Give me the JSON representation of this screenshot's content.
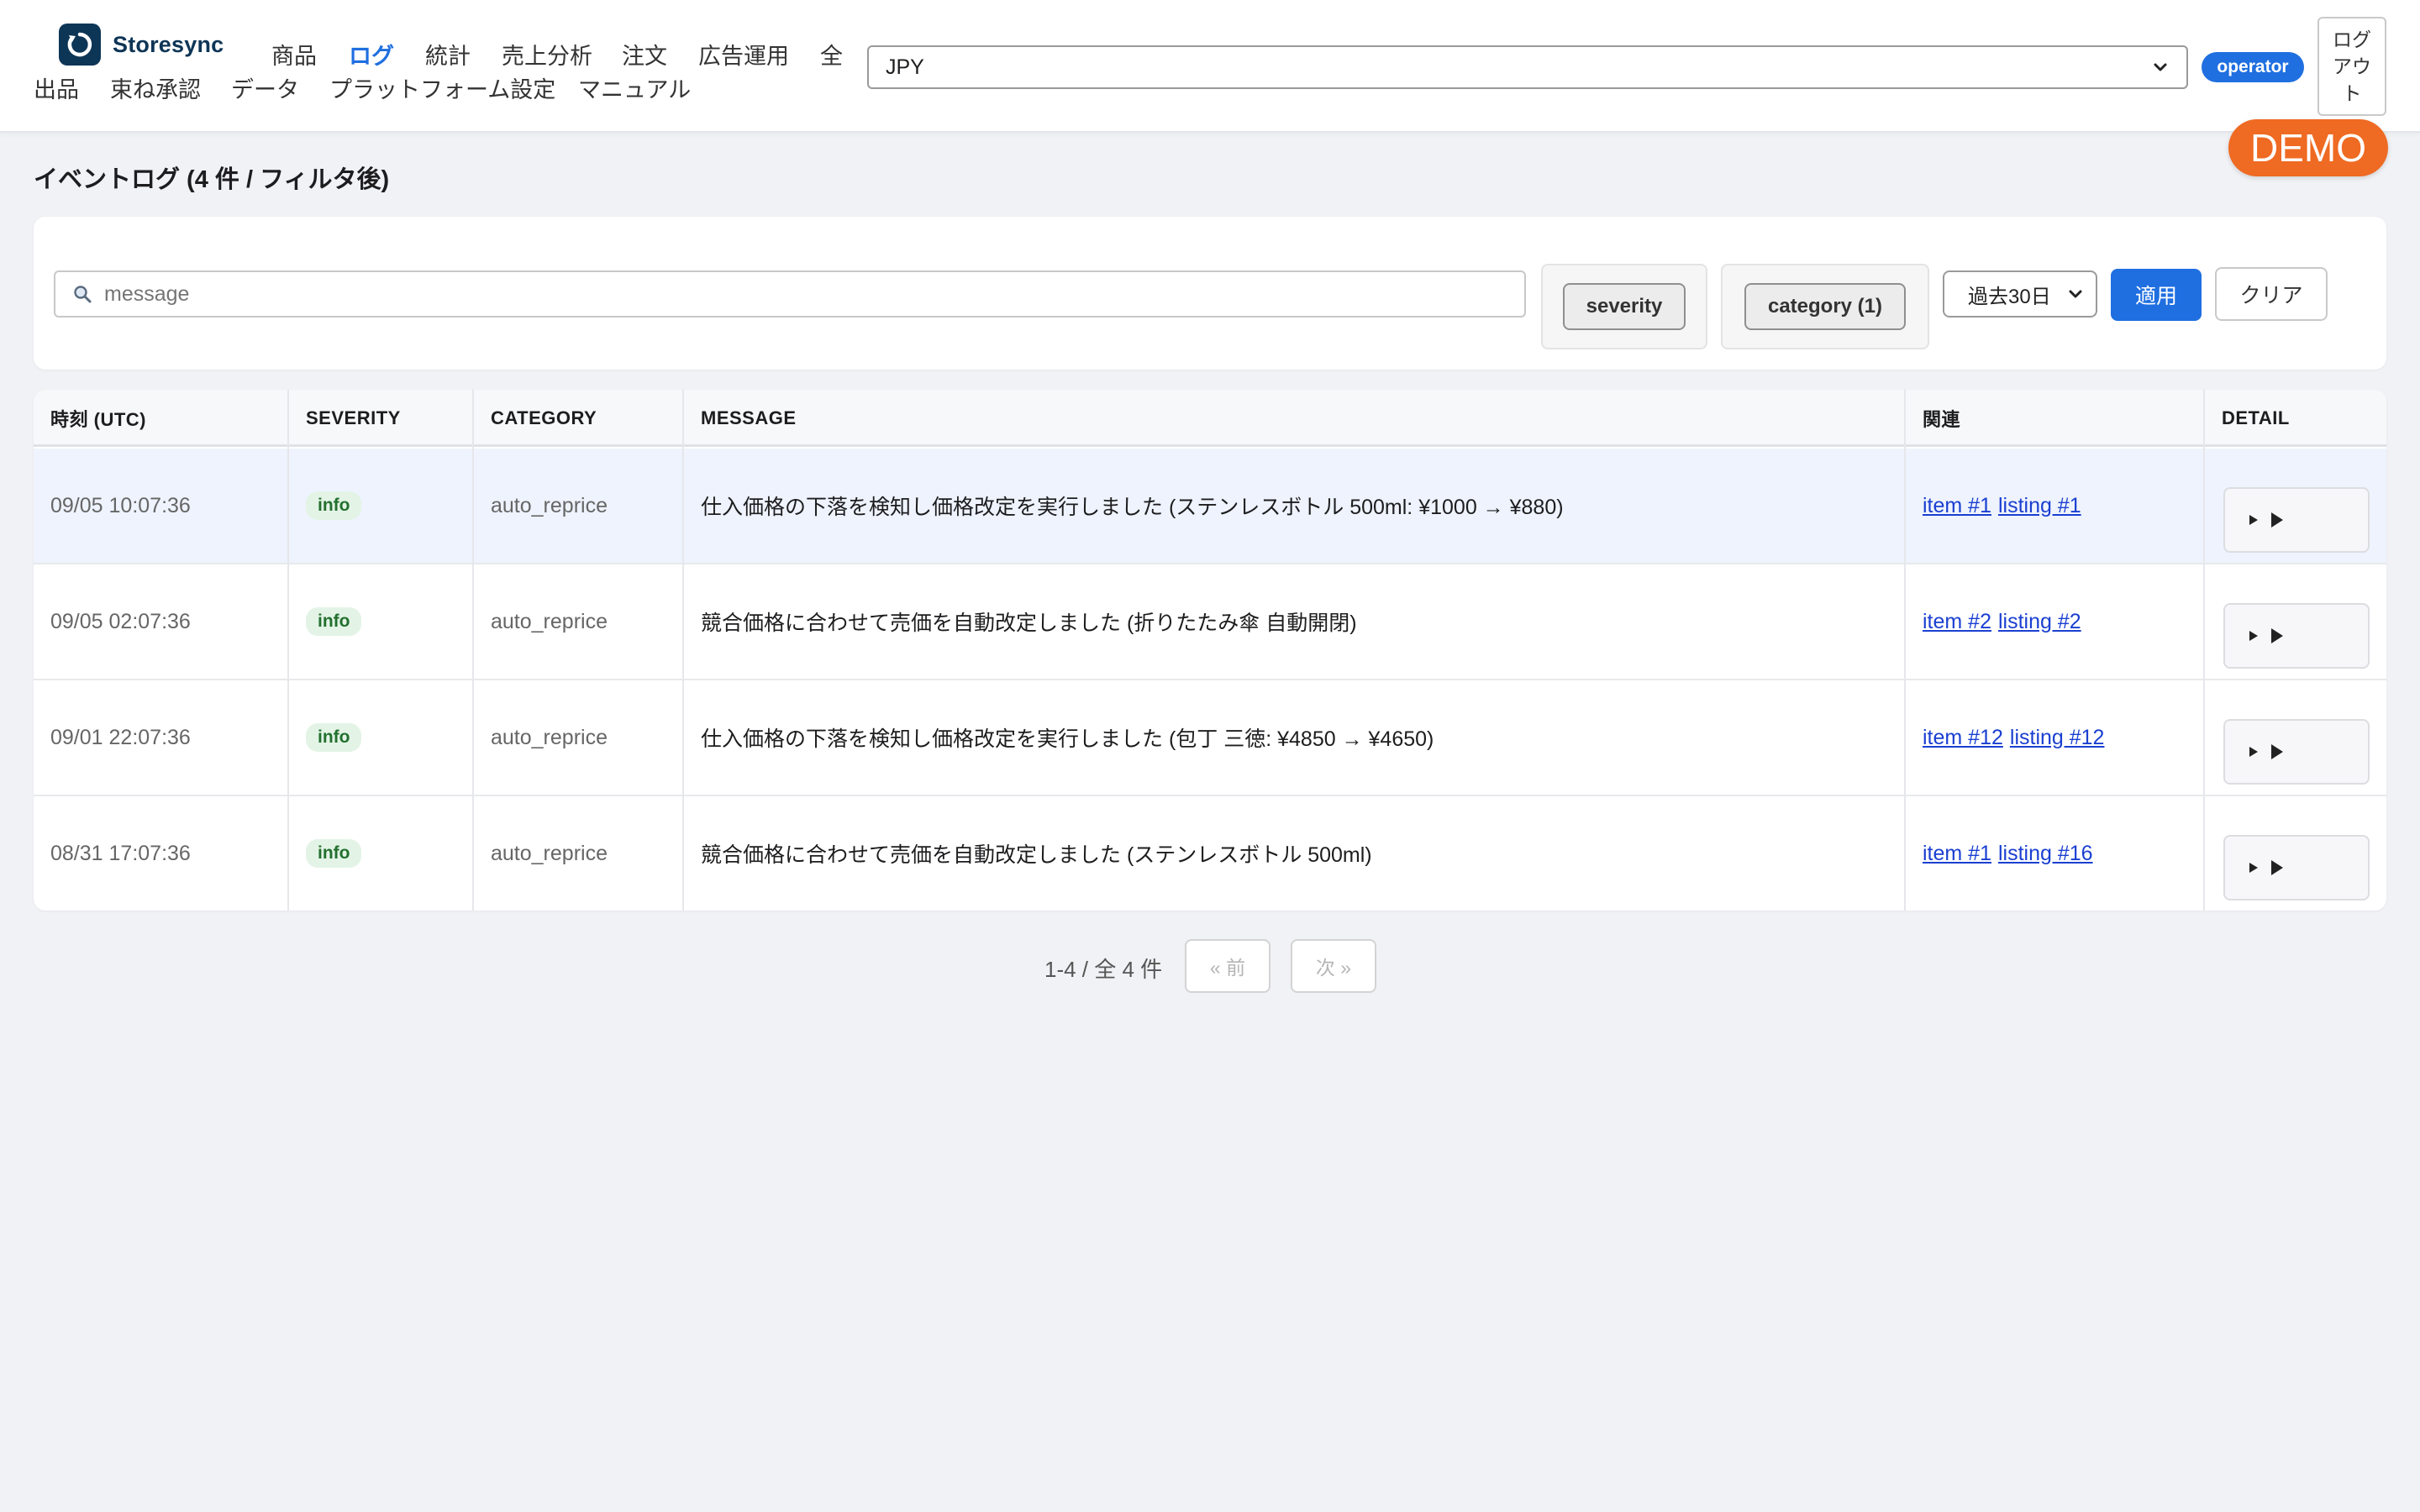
{
  "app": {
    "brand": "Storesync",
    "nav": [
      {
        "label": "商品",
        "active": false
      },
      {
        "label": "ログ",
        "active": true
      },
      {
        "label": "統計",
        "active": false
      },
      {
        "label": "売上分析",
        "active": false
      },
      {
        "label": "注文",
        "active": false
      },
      {
        "label": "広告運用",
        "active": false
      },
      {
        "label": "全",
        "active": false
      },
      {
        "label": "出品",
        "active": false
      },
      {
        "label": "束ね承認",
        "active": false
      },
      {
        "label": "データ",
        "active": false
      },
      {
        "label": "プラットフォーム設定",
        "active": false
      },
      {
        "label": "マニュアル",
        "active": false
      }
    ],
    "currency": "JPY",
    "role": "operator",
    "logout": "ログアウト",
    "demo": "DEMO"
  },
  "page": {
    "title": "イベントログ (4 件 / フィルタ後)"
  },
  "filters": {
    "search_placeholder": "message",
    "severity_label": "severity",
    "category_label": "category (1)",
    "range_value": "過去30日",
    "apply_label": "適用",
    "clear_label": "クリア"
  },
  "table": {
    "headers": [
      "時刻 (UTC)",
      "SEVERITY",
      "CATEGORY",
      "MESSAGE",
      "関連",
      "DETAIL"
    ],
    "rows": [
      {
        "time": "09/05 10:07:36",
        "severity": "info",
        "category": "auto_reprice",
        "message": "仕入価格の下落を検知し価格改定を実行しました (ステンレスボトル 500ml: ¥1000 → ¥880)",
        "item": "item #1",
        "listing": "listing #1"
      },
      {
        "time": "09/05 02:07:36",
        "severity": "info",
        "category": "auto_reprice",
        "message": "競合価格に合わせて売価を自動改定しました (折りたたみ傘 自動開閉)",
        "item": "item #2",
        "listing": "listing #2"
      },
      {
        "time": "09/01 22:07:36",
        "severity": "info",
        "category": "auto_reprice",
        "message": "仕入価格の下落を検知し価格改定を実行しました (包丁 三徳: ¥4850 → ¥4650)",
        "item": "item #12",
        "listing": "listing #12"
      },
      {
        "time": "08/31 17:07:36",
        "severity": "info",
        "category": "auto_reprice",
        "message": "競合価格に合わせて売価を自動改定しました (ステンレスボトル 500ml)",
        "item": "item #1",
        "listing": "listing #16"
      }
    ]
  },
  "pagination": {
    "info": "1-4 / 全 4 件",
    "prev": "« 前",
    "next": "次 »"
  },
  "colors": {
    "accent": "#1f6fe0",
    "demo": "#ef6a22",
    "severity_info_bg": "#e3f4e6",
    "severity_info_text": "#23702f"
  }
}
